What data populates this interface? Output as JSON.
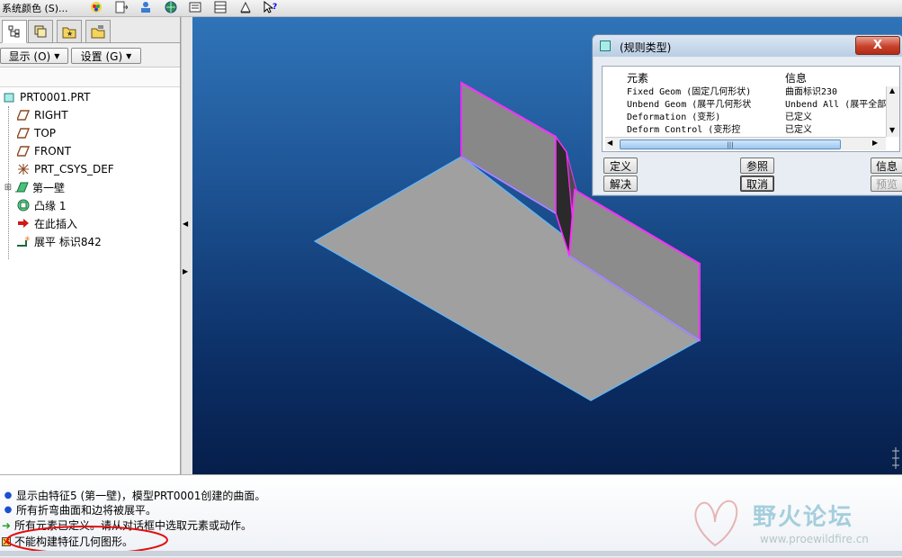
{
  "toolbar": {
    "menu_label": "系统颜色 (S)...",
    "icons": [
      "color-wheel-icon",
      "export-icon",
      "person-icon",
      "globe-icon",
      "print-icon",
      "layout-icon",
      "measure-icon",
      "help-cursor-icon"
    ]
  },
  "left_panel": {
    "tabs": [
      "model-tree-icon",
      "layers-icon",
      "favorites-icon",
      "tools-icon"
    ],
    "show_button": "显示 (O)",
    "settings_button": "设置 (G)",
    "tree": [
      {
        "label": "PRT0001.PRT",
        "icon": "part-icon"
      },
      {
        "label": "RIGHT",
        "icon": "datum-plane-icon"
      },
      {
        "label": "TOP",
        "icon": "datum-plane-icon"
      },
      {
        "label": "FRONT",
        "icon": "datum-plane-icon"
      },
      {
        "label": "PRT_CSYS_DEF",
        "icon": "csys-icon"
      },
      {
        "label": "第一壁",
        "icon": "sheetmetal-wall-icon"
      },
      {
        "label": "凸缘 1",
        "icon": "flange-icon"
      },
      {
        "label": "在此插入",
        "icon": "insert-arrow-icon"
      },
      {
        "label": "展平 标识842",
        "icon": "unbend-icon"
      }
    ]
  },
  "dialog": {
    "title": "(规则类型)",
    "col_element": "元素",
    "col_info": "信息",
    "rows": [
      {
        "element": "Fixed Geom (固定几何形状)",
        "info": "曲面标识230"
      },
      {
        "element": "Unbend Geom (展平几何形状",
        "info": "Unbend All (展平全部"
      },
      {
        "element": "Deformation (变形)",
        "info": "已定义"
      },
      {
        "element": "Deform Control (变形控",
        "info": "已定义"
      }
    ],
    "btn_define": "定义",
    "btn_refs": "参照",
    "btn_info": "信息",
    "btn_resolve": "解决",
    "btn_cancel": "取消",
    "btn_preview": "预览",
    "close": "X"
  },
  "messages": [
    {
      "text": "显示由特征5 (第一壁)，模型PRT0001创建的曲面。",
      "icon": "info-dot-icon"
    },
    {
      "text": "所有折弯曲面和边将被展平。",
      "icon": "info-dot-icon"
    },
    {
      "text": "所有元素已定义。请从对话框中选取元素或动作。",
      "icon": "prompt-arrow-icon"
    },
    {
      "text": "不能构建特征几何图形。",
      "icon": "error-icon"
    }
  ],
  "watermark": {
    "title": "野火论坛",
    "url": "www.proewildfire.cn"
  },
  "colors": {
    "selection_edge": "#ff2dff",
    "model_edge": "#4fb3ff",
    "annotation_circle": "#e01010"
  }
}
